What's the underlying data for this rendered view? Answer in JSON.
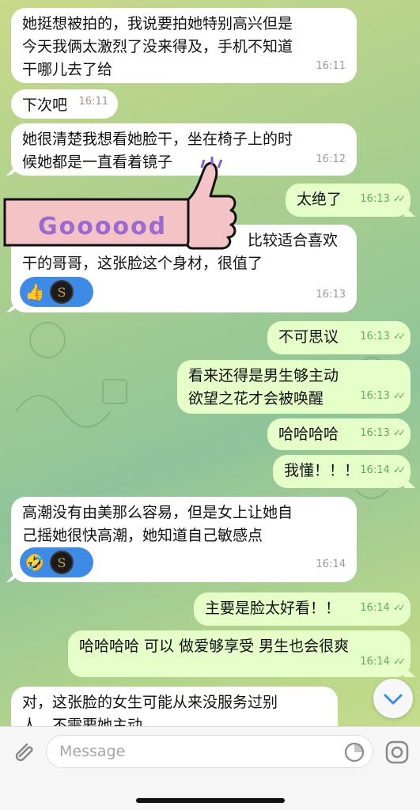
{
  "messages": [
    {
      "text_lines": [
        "她挺想被拍的，我说要拍她特别高兴但是",
        "今天我俩太激烈了没来得及，手机不知道",
        "干哪儿去了给"
      ],
      "time": "16:11"
    },
    {
      "text": "下次吧",
      "time": "16:11"
    },
    {
      "text_lines": [
        "她很清楚我想看她脸干，坐在椅子上的时",
        "候她都是一直看着镜子"
      ],
      "time": "16:12"
    },
    {
      "text": "太绝了",
      "time": "16:13"
    },
    {
      "text_lines": [
        "比较适合喜欢",
        "干的哥哥，这张脸这个身材，很值了"
      ],
      "time": "16:13",
      "reaction_emoji": "👍"
    },
    {
      "text": "不可思议",
      "time": "16:13"
    },
    {
      "text_lines": [
        "看来还得是男生够主动",
        "欲望之花才会被唤醒"
      ],
      "time": "16:13"
    },
    {
      "text": "哈哈哈哈",
      "time": "16:13"
    },
    {
      "text": "我懂！！！",
      "time": "16:14"
    },
    {
      "text_lines": [
        "高潮没有由美那么容易，但是女上让她自",
        "己摇她很快高潮，她知道自己敏感点"
      ],
      "time": "16:14",
      "reaction_emoji": "🤣"
    },
    {
      "text": "主要是脸太好看！！",
      "time": "16:14"
    },
    {
      "text": "哈哈哈哈 可以 做爱够享受 男生也会很爽",
      "time": "16:14"
    },
    {
      "text_lines": [
        "对，这张脸的女生可能从来没服务过别",
        "人，不需要她主动"
      ]
    }
  ],
  "sticker": {
    "text": "Goooood"
  },
  "avatar_letter": "S",
  "composer": {
    "placeholder": "Message"
  },
  "colors": {
    "incoming": "#ffffff",
    "outgoing": "#e6ffc9",
    "reaction": "#3d8be6",
    "time_out": "#5fae57"
  },
  "icons": [
    "attach-icon",
    "sticker-icon",
    "camera-icon",
    "chevron-down-icon",
    "double-check-icon"
  ]
}
